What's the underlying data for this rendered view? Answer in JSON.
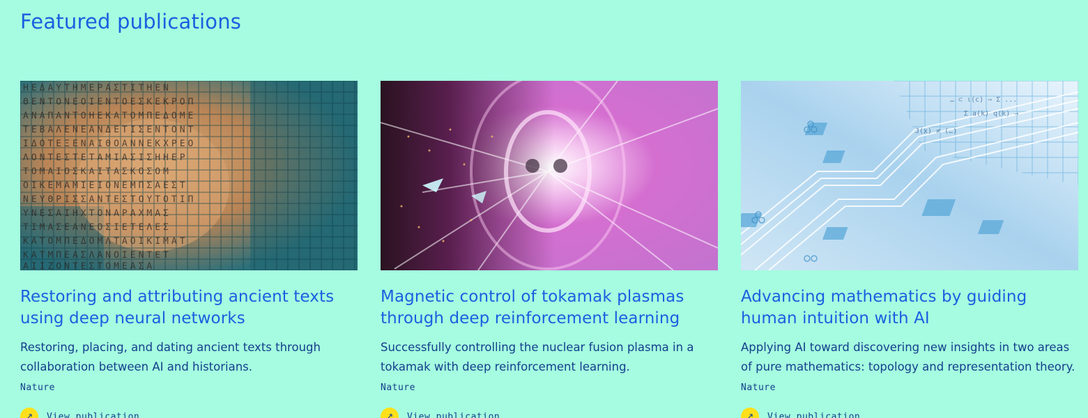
{
  "section": {
    "title": "Featured publications"
  },
  "cards": [
    {
      "title": "Restoring and attributing ancient texts using deep neural networks",
      "description": "Restoring, placing, and dating ancient texts through collaboration between AI and historians.",
      "journal": "Nature",
      "link_label": "View publication",
      "image_icon": "ancient-inscription-image"
    },
    {
      "title": "Magnetic control of tokamak plasmas through deep reinforcement learning",
      "description": "Successfully controlling the nuclear fusion plasma in a tokamak with deep reinforcement learning.",
      "journal": "Nature",
      "link_label": "View publication",
      "image_icon": "tokamak-plasma-image"
    },
    {
      "title": "Advancing mathematics by guiding human intuition with AI",
      "description": "Applying AI toward discovering new insights in two areas of pure mathematics: topology and representation theory.",
      "journal": "Nature",
      "link_label": "View publication",
      "image_icon": "circuit-math-image"
    }
  ],
  "colors": {
    "background": "#a5fce0",
    "title": "#1a5fe0",
    "body_text": "#143f8c",
    "link_dot": "#ffe01a"
  }
}
